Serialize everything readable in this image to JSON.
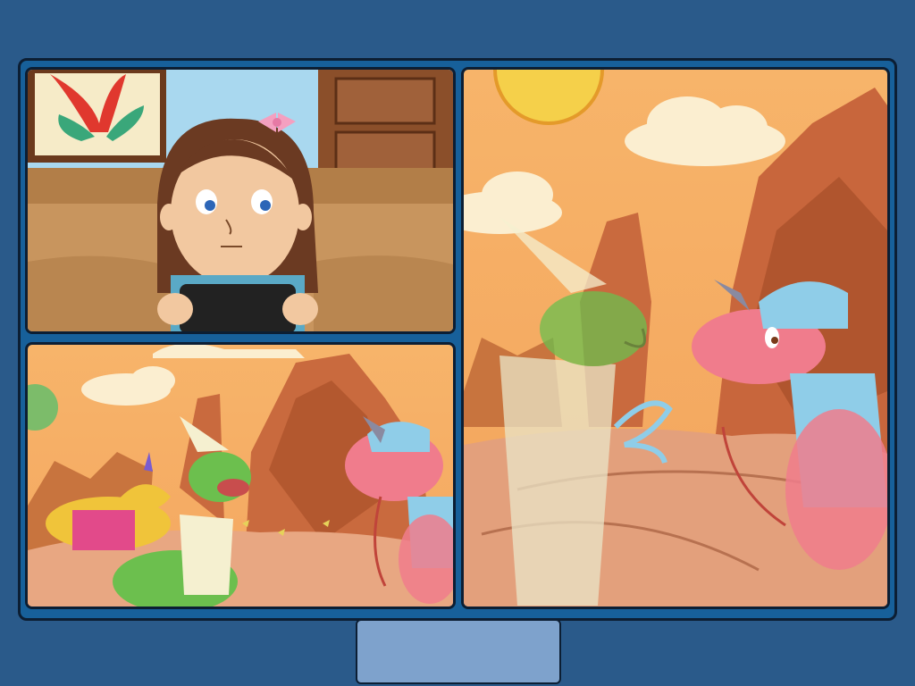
{
  "comic": {
    "panels": [
      {
        "id": "panel-1",
        "scene": "girl-playing-handheld-console"
      },
      {
        "id": "panel-2",
        "scene": "dinosaur-party-in-desert"
      },
      {
        "id": "panel-3",
        "scene": "wizard-dino-and-knight-dino"
      }
    ]
  },
  "controls": {
    "next_label": ""
  },
  "colors": {
    "background": "#2a5a8a",
    "frame": "#17609a",
    "border": "#0c1e33",
    "button": "#7ea2cc"
  }
}
